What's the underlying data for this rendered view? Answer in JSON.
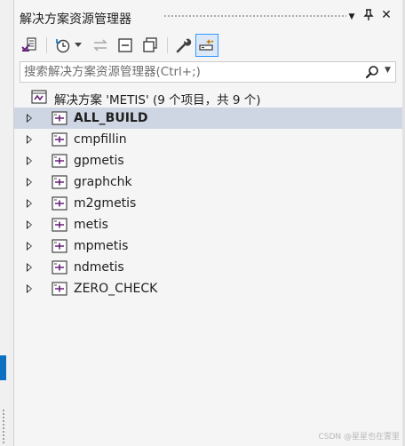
{
  "panel": {
    "title": "解决方案资源管理器",
    "title_buttons": {
      "dropdown": "▼",
      "pin": "📌",
      "close": "✕"
    }
  },
  "toolbar": {
    "icons": [
      "vs-project-icon",
      "history-icon",
      "dropdown-icon",
      "sync-icon",
      "collapse-all-icon",
      "show-all-files-icon",
      "properties-wrench-icon",
      "preview-selected-icon"
    ]
  },
  "search": {
    "placeholder": "搜索解决方案资源管理器(Ctrl+;)",
    "value": ""
  },
  "solution": {
    "label": "解决方案 'METIS' (9 个项目，共 9 个)"
  },
  "projects": [
    {
      "name": "ALL_BUILD",
      "selected": true
    },
    {
      "name": "cmpfillin",
      "selected": false
    },
    {
      "name": "gpmetis",
      "selected": false
    },
    {
      "name": "graphchk",
      "selected": false
    },
    {
      "name": "m2gmetis",
      "selected": false
    },
    {
      "name": "metis",
      "selected": false
    },
    {
      "name": "mpmetis",
      "selected": false
    },
    {
      "name": "ndmetis",
      "selected": false
    },
    {
      "name": "ZERO_CHECK",
      "selected": false
    }
  ],
  "watermark": "CSDN @星星也在雾里",
  "colors": {
    "accent": "#0e70c0",
    "selected_row": "#cfd6e3",
    "project_icon": "#68217a"
  }
}
